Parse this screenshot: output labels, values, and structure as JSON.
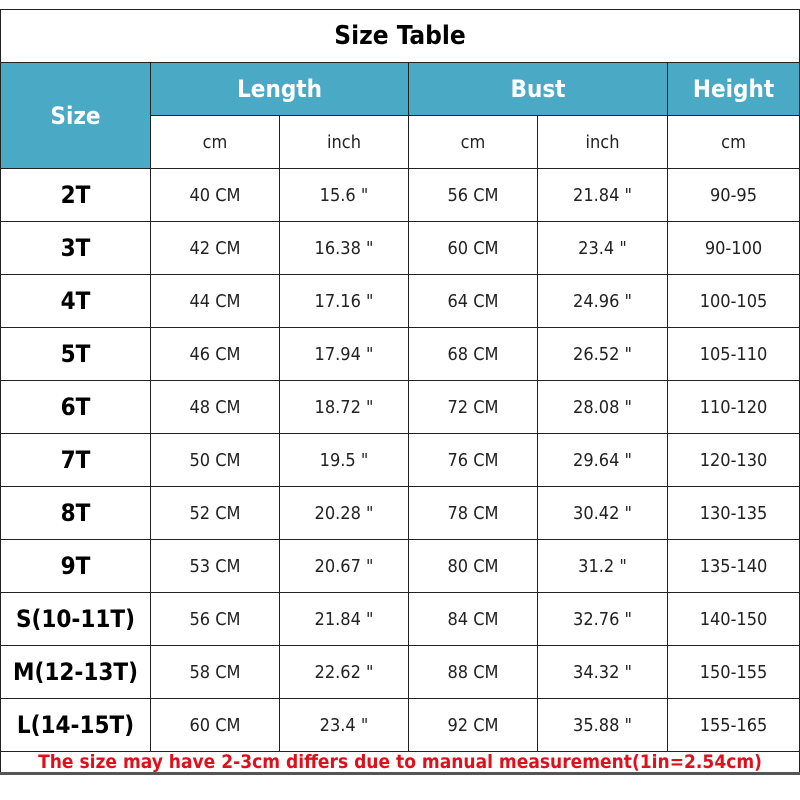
{
  "title": "Size Table",
  "header": {
    "size": "Size",
    "length": "Length",
    "bust": "Bust",
    "height": "Height",
    "units": [
      "cm",
      "inch",
      "cm",
      "inch",
      "cm"
    ]
  },
  "rows": [
    [
      "2T",
      "40 CM",
      "15.6 \"",
      "56 CM",
      "21.84 \"",
      "90-95"
    ],
    [
      "3T",
      "42 CM",
      "16.38 \"",
      "60 CM",
      "23.4 \"",
      "90-100"
    ],
    [
      "4T",
      "44 CM",
      "17.16 \"",
      "64 CM",
      "24.96 \"",
      "100-105"
    ],
    [
      "5T",
      "46 CM",
      "17.94 \"",
      "68 CM",
      "26.52 \"",
      "105-110"
    ],
    [
      "6T",
      "48 CM",
      "18.72 \"",
      "72 CM",
      "28.08 \"",
      "110-120"
    ],
    [
      "7T",
      "50 CM",
      "19.5 \"",
      "76 CM",
      "29.64 \"",
      "120-130"
    ],
    [
      "8T",
      "52 CM",
      "20.28 \"",
      "78 CM",
      "30.42 \"",
      "130-135"
    ],
    [
      "9T",
      "53 CM",
      "20.67 \"",
      "80 CM",
      "31.2 \"",
      "135-140"
    ],
    [
      "S(10-11T)",
      "56 CM",
      "21.84 \"",
      "84 CM",
      "32.76 \"",
      "140-150"
    ],
    [
      "M(12-13T)",
      "58 CM",
      "22.62 \"",
      "88 CM",
      "34.32 \"",
      "150-155"
    ],
    [
      "L(14-15T)",
      "60 CM",
      "23.4 \"",
      "92 CM",
      "35.88 \"",
      "155-165"
    ]
  ],
  "note": "The size may have 2-3cm differs due to manual measurement(1in=2.54cm)",
  "colors": {
    "header_bg": "#4aa9c4",
    "note_text": "#e0101a"
  }
}
